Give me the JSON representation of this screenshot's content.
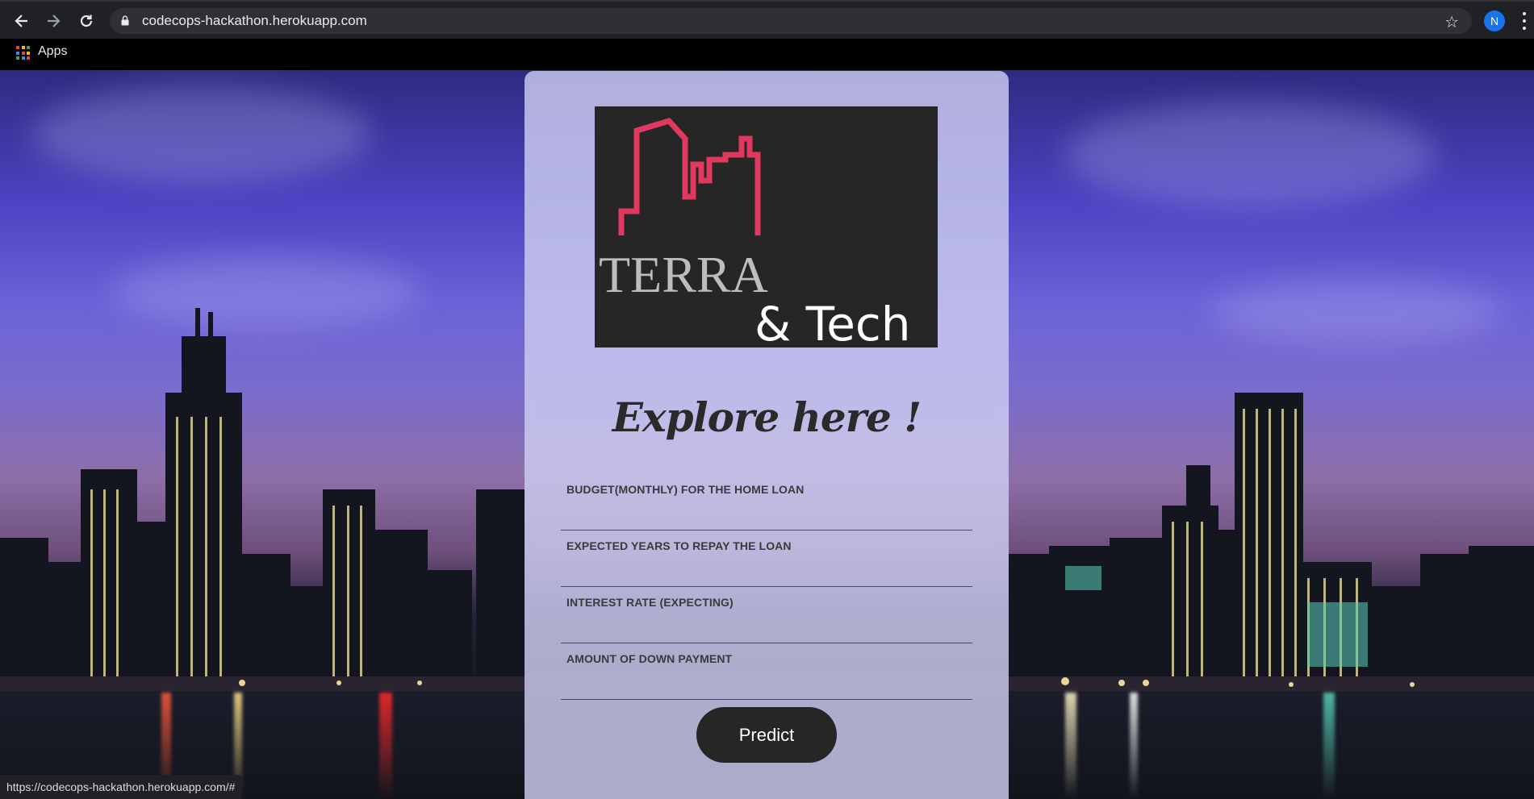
{
  "browser": {
    "url": "codecops-hackathon.herokuapp.com",
    "profile_initial": "N",
    "bookmarks": {
      "apps_label": "Apps"
    },
    "status_url": "https://codecops-hackathon.herokuapp.com/#"
  },
  "logo": {
    "name": "TERRA",
    "subname": "& Tech",
    "colors": {
      "background": "#262626",
      "outline": "#e0385e",
      "text_terra": "#bdbdbd",
      "text_tech": "#ffffff"
    }
  },
  "form": {
    "title": "Explore here !",
    "fields": [
      {
        "label": "BUDGET(MONTHLY) FOR THE HOME LOAN",
        "value": ""
      },
      {
        "label": "EXPECTED YEARS TO REPAY THE LOAN",
        "value": ""
      },
      {
        "label": "INTEREST RATE (EXPECTING)",
        "value": ""
      },
      {
        "label": "AMOUNT OF DOWN PAYMENT",
        "value": ""
      }
    ],
    "submit_label": "Predict"
  },
  "icons": {
    "back": "back-arrow-icon",
    "forward": "forward-arrow-icon",
    "reload": "reload-icon",
    "lock": "lock-icon",
    "star": "star-icon",
    "apps": "apps-grid-icon",
    "menu": "menu-dots-icon"
  },
  "colors": {
    "chrome_bg": "#202124",
    "omnibox_bg": "#2f3034",
    "avatar": "#1a73e8",
    "button_bg": "#262626"
  }
}
